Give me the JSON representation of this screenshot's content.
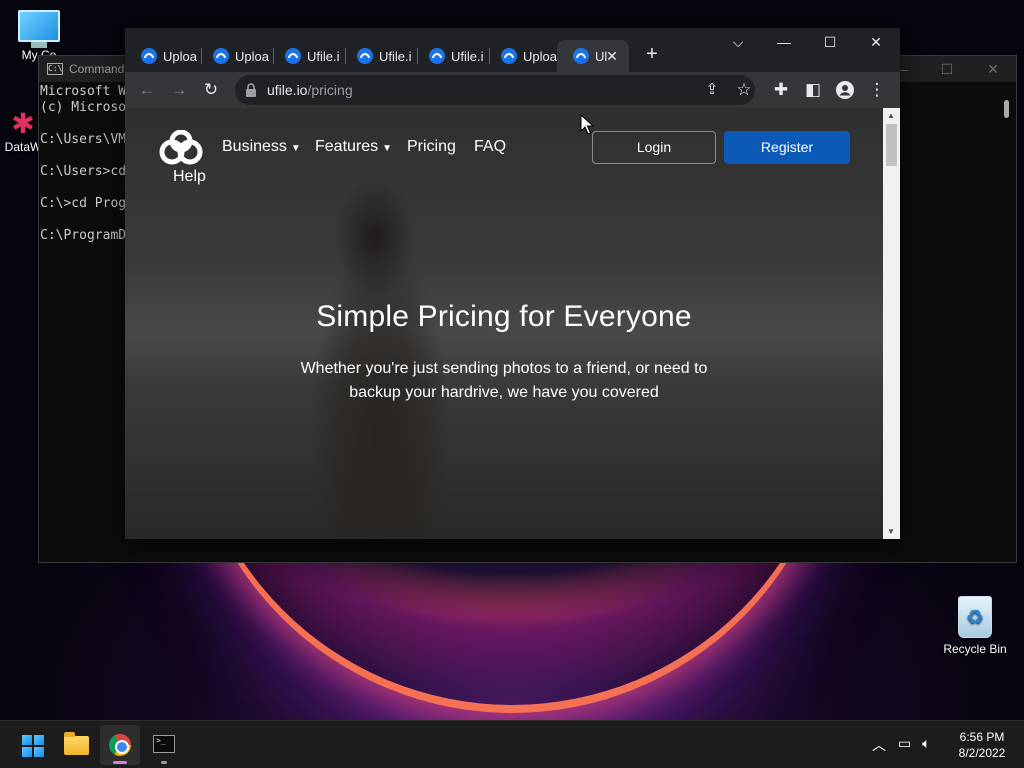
{
  "desktop": {
    "icons": {
      "my_computer": "My Co",
      "dataw": "DataW",
      "recycle_bin": "Recycle Bin"
    }
  },
  "cmd": {
    "title": "Command",
    "lines": [
      "Microsoft W",
      "(c) Microso",
      "",
      "C:\\Users\\VM",
      "",
      "C:\\Users>cd",
      "",
      "C:\\>cd Prog",
      "",
      "C:\\ProgramD"
    ]
  },
  "browser": {
    "tabs": [
      {
        "title": "Uploa"
      },
      {
        "title": "Uploa"
      },
      {
        "title": "Ufile.i"
      },
      {
        "title": "Ufile.i"
      },
      {
        "title": "Ufile.i"
      },
      {
        "title": "Uploa"
      },
      {
        "title": "Ul",
        "active": true
      }
    ],
    "new_tab": "+",
    "url_host": "ufile.io",
    "url_path": "/pricing"
  },
  "site": {
    "help": "Help",
    "nav": {
      "business": "Business",
      "features": "Features",
      "pricing": "Pricing",
      "faq": "FAQ"
    },
    "login": "Login",
    "register": "Register",
    "hero_title": "Simple Pricing for Everyone",
    "hero_subtitle": "Whether you're just sending photos to a friend, or need to backup your hardrive, we have you covered"
  },
  "taskbar": {
    "time": "6:56 PM",
    "date": "8/2/2022"
  },
  "colors": {
    "register_button": "#0b5ab8",
    "chrome_tabstrip": "#202124",
    "chrome_toolbar": "#35363a",
    "taskbar": "#1c1c1c"
  }
}
